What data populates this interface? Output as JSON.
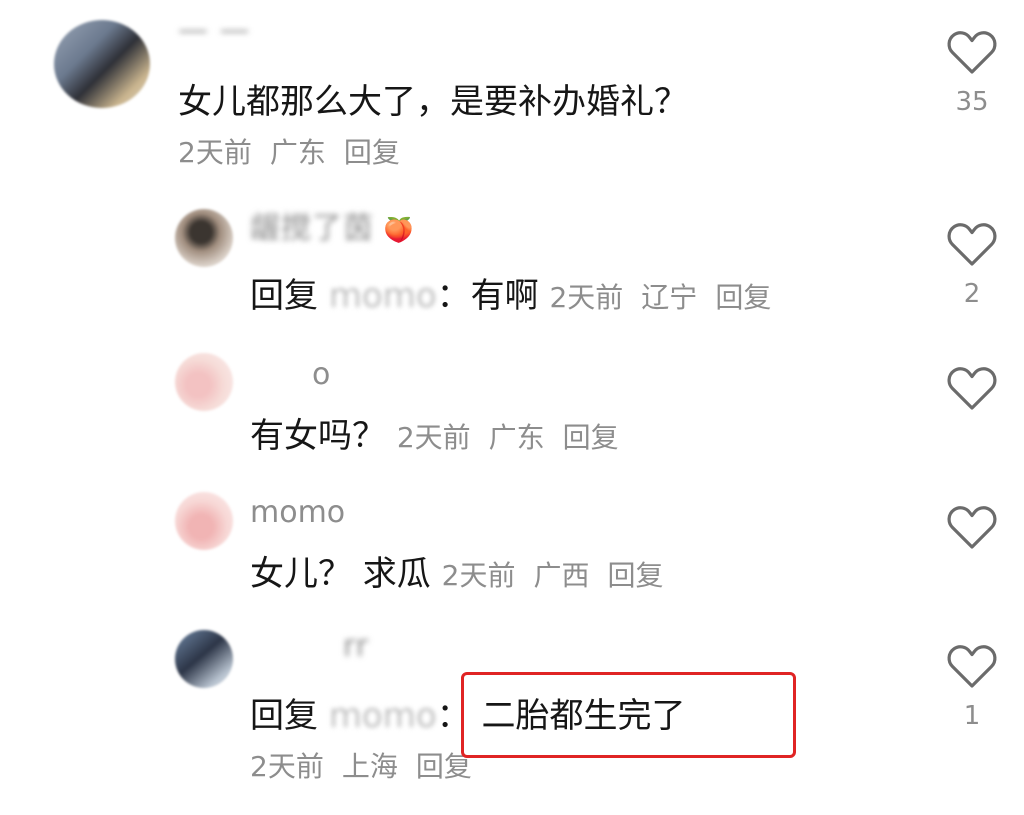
{
  "comments": [
    {
      "username": "— —",
      "text": "女儿都那么大了，是要补办婚礼？",
      "time": "2天前",
      "location": "广东",
      "reply_label": "回复",
      "likes": "35"
    },
    {
      "username": "龌搅了茵",
      "badge": "🍑",
      "prefix": "回复",
      "mention": "momo",
      "colon": "：",
      "text": "有啊",
      "time": "2天前",
      "location": "辽宁",
      "reply_label": "回复",
      "likes": "2"
    },
    {
      "username": "o",
      "text": "有女吗？",
      "time": "2天前",
      "location": "广东",
      "reply_label": "回复",
      "likes": ""
    },
    {
      "username": "momo",
      "text": "女儿？ 求瓜",
      "time": "2天前",
      "location": "广西",
      "reply_label": "回复",
      "likes": ""
    },
    {
      "username": "rr",
      "prefix": "回复",
      "mention": "momo",
      "colon": "：",
      "text": "二胎都生完了",
      "time": "2天前",
      "location": "上海",
      "reply_label": "回复",
      "likes": "1"
    }
  ],
  "colors": {
    "highlight": "#e02424",
    "meta": "#8d8d8d",
    "text": "#161616"
  },
  "icons": {
    "like": "heart-outline-icon"
  }
}
